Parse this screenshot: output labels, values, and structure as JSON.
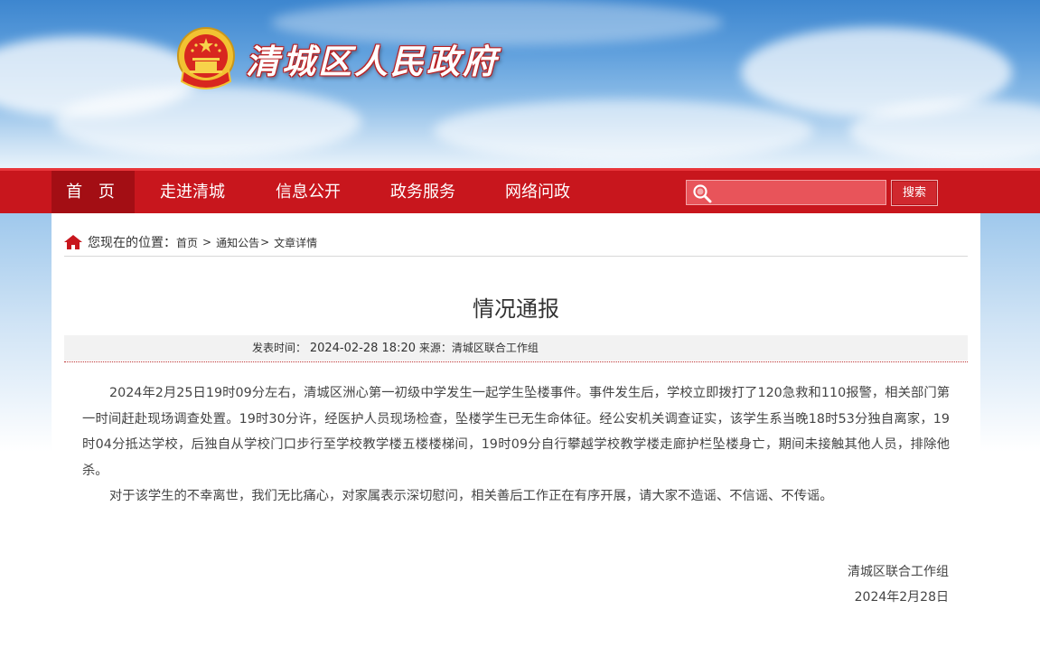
{
  "site": {
    "title": "清城区人民政府"
  },
  "nav": {
    "items": [
      {
        "label": "首 页"
      },
      {
        "label": "走进清城"
      },
      {
        "label": "信息公开"
      },
      {
        "label": "政务服务"
      },
      {
        "label": "网络问政"
      }
    ],
    "search_placeholder": "",
    "search_button": "搜索"
  },
  "breadcrumb": {
    "prefix": "您现在的位置：",
    "items": [
      "首页",
      "通知公告",
      "文章详情"
    ],
    "sep1": ">",
    "sep2": ">"
  },
  "article": {
    "title": "情况通报",
    "meta_label": "发表时间：",
    "meta_date": "2024-02-28 18:20",
    "meta_source": "来源：清城区联合工作组",
    "paragraphs": [
      "2024年2月25日19时09分左右，清城区洲心第一初级中学发生一起学生坠楼事件。事件发生后，学校立即拨打了120急救和110报警，相关部门第一时间赶赴现场调查处置。19时30分许，经医护人员现场检查，坠楼学生已无生命体征。经公安机关调查证实，该学生系当晚18时53分独自离家，19时04分抵达学校，后独自从学校门口步行至学校教学楼五楼楼梯间，19时09分自行攀越学校教学楼走廊护栏坠楼身亡，期间未接触其他人员，排除他杀。",
      "对于该学生的不幸离世，我们无比痛心，对家属表示深切慰问，相关善后工作正在有序开展，请大家不造谣、不信谣、不传谣。"
    ],
    "signature": "清城区联合工作组",
    "sign_date": "2024年2月28日"
  },
  "colors": {
    "nav_red": "#c8161d",
    "nav_active": "#a30e14"
  }
}
